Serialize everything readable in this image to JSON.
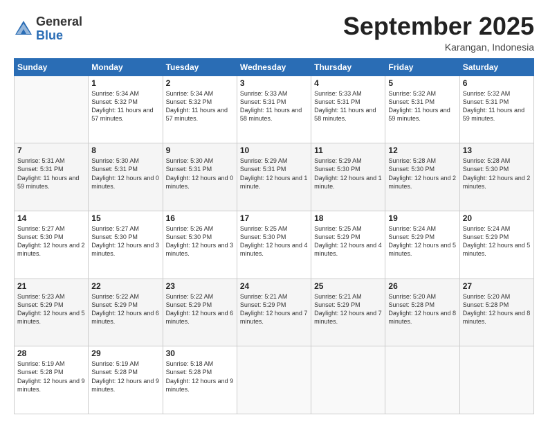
{
  "logo": {
    "general": "General",
    "blue": "Blue"
  },
  "header": {
    "month": "September 2025",
    "location": "Karangan, Indonesia"
  },
  "weekdays": [
    "Sunday",
    "Monday",
    "Tuesday",
    "Wednesday",
    "Thursday",
    "Friday",
    "Saturday"
  ],
  "weeks": [
    [
      {
        "day": "",
        "sunrise": "",
        "sunset": "",
        "daylight": ""
      },
      {
        "day": "1",
        "sunrise": "Sunrise: 5:34 AM",
        "sunset": "Sunset: 5:32 PM",
        "daylight": "Daylight: 11 hours and 57 minutes."
      },
      {
        "day": "2",
        "sunrise": "Sunrise: 5:34 AM",
        "sunset": "Sunset: 5:32 PM",
        "daylight": "Daylight: 11 hours and 57 minutes."
      },
      {
        "day": "3",
        "sunrise": "Sunrise: 5:33 AM",
        "sunset": "Sunset: 5:31 PM",
        "daylight": "Daylight: 11 hours and 58 minutes."
      },
      {
        "day": "4",
        "sunrise": "Sunrise: 5:33 AM",
        "sunset": "Sunset: 5:31 PM",
        "daylight": "Daylight: 11 hours and 58 minutes."
      },
      {
        "day": "5",
        "sunrise": "Sunrise: 5:32 AM",
        "sunset": "Sunset: 5:31 PM",
        "daylight": "Daylight: 11 hours and 59 minutes."
      },
      {
        "day": "6",
        "sunrise": "Sunrise: 5:32 AM",
        "sunset": "Sunset: 5:31 PM",
        "daylight": "Daylight: 11 hours and 59 minutes."
      }
    ],
    [
      {
        "day": "7",
        "sunrise": "Sunrise: 5:31 AM",
        "sunset": "Sunset: 5:31 PM",
        "daylight": "Daylight: 11 hours and 59 minutes."
      },
      {
        "day": "8",
        "sunrise": "Sunrise: 5:30 AM",
        "sunset": "Sunset: 5:31 PM",
        "daylight": "Daylight: 12 hours and 0 minutes."
      },
      {
        "day": "9",
        "sunrise": "Sunrise: 5:30 AM",
        "sunset": "Sunset: 5:31 PM",
        "daylight": "Daylight: 12 hours and 0 minutes."
      },
      {
        "day": "10",
        "sunrise": "Sunrise: 5:29 AM",
        "sunset": "Sunset: 5:31 PM",
        "daylight": "Daylight: 12 hours and 1 minute."
      },
      {
        "day": "11",
        "sunrise": "Sunrise: 5:29 AM",
        "sunset": "Sunset: 5:30 PM",
        "daylight": "Daylight: 12 hours and 1 minute."
      },
      {
        "day": "12",
        "sunrise": "Sunrise: 5:28 AM",
        "sunset": "Sunset: 5:30 PM",
        "daylight": "Daylight: 12 hours and 2 minutes."
      },
      {
        "day": "13",
        "sunrise": "Sunrise: 5:28 AM",
        "sunset": "Sunset: 5:30 PM",
        "daylight": "Daylight: 12 hours and 2 minutes."
      }
    ],
    [
      {
        "day": "14",
        "sunrise": "Sunrise: 5:27 AM",
        "sunset": "Sunset: 5:30 PM",
        "daylight": "Daylight: 12 hours and 2 minutes."
      },
      {
        "day": "15",
        "sunrise": "Sunrise: 5:27 AM",
        "sunset": "Sunset: 5:30 PM",
        "daylight": "Daylight: 12 hours and 3 minutes."
      },
      {
        "day": "16",
        "sunrise": "Sunrise: 5:26 AM",
        "sunset": "Sunset: 5:30 PM",
        "daylight": "Daylight: 12 hours and 3 minutes."
      },
      {
        "day": "17",
        "sunrise": "Sunrise: 5:25 AM",
        "sunset": "Sunset: 5:30 PM",
        "daylight": "Daylight: 12 hours and 4 minutes."
      },
      {
        "day": "18",
        "sunrise": "Sunrise: 5:25 AM",
        "sunset": "Sunset: 5:29 PM",
        "daylight": "Daylight: 12 hours and 4 minutes."
      },
      {
        "day": "19",
        "sunrise": "Sunrise: 5:24 AM",
        "sunset": "Sunset: 5:29 PM",
        "daylight": "Daylight: 12 hours and 5 minutes."
      },
      {
        "day": "20",
        "sunrise": "Sunrise: 5:24 AM",
        "sunset": "Sunset: 5:29 PM",
        "daylight": "Daylight: 12 hours and 5 minutes."
      }
    ],
    [
      {
        "day": "21",
        "sunrise": "Sunrise: 5:23 AM",
        "sunset": "Sunset: 5:29 PM",
        "daylight": "Daylight: 12 hours and 5 minutes."
      },
      {
        "day": "22",
        "sunrise": "Sunrise: 5:22 AM",
        "sunset": "Sunset: 5:29 PM",
        "daylight": "Daylight: 12 hours and 6 minutes."
      },
      {
        "day": "23",
        "sunrise": "Sunrise: 5:22 AM",
        "sunset": "Sunset: 5:29 PM",
        "daylight": "Daylight: 12 hours and 6 minutes."
      },
      {
        "day": "24",
        "sunrise": "Sunrise: 5:21 AM",
        "sunset": "Sunset: 5:29 PM",
        "daylight": "Daylight: 12 hours and 7 minutes."
      },
      {
        "day": "25",
        "sunrise": "Sunrise: 5:21 AM",
        "sunset": "Sunset: 5:29 PM",
        "daylight": "Daylight: 12 hours and 7 minutes."
      },
      {
        "day": "26",
        "sunrise": "Sunrise: 5:20 AM",
        "sunset": "Sunset: 5:28 PM",
        "daylight": "Daylight: 12 hours and 8 minutes."
      },
      {
        "day": "27",
        "sunrise": "Sunrise: 5:20 AM",
        "sunset": "Sunset: 5:28 PM",
        "daylight": "Daylight: 12 hours and 8 minutes."
      }
    ],
    [
      {
        "day": "28",
        "sunrise": "Sunrise: 5:19 AM",
        "sunset": "Sunset: 5:28 PM",
        "daylight": "Daylight: 12 hours and 9 minutes."
      },
      {
        "day": "29",
        "sunrise": "Sunrise: 5:19 AM",
        "sunset": "Sunset: 5:28 PM",
        "daylight": "Daylight: 12 hours and 9 minutes."
      },
      {
        "day": "30",
        "sunrise": "Sunrise: 5:18 AM",
        "sunset": "Sunset: 5:28 PM",
        "daylight": "Daylight: 12 hours and 9 minutes."
      },
      {
        "day": "",
        "sunrise": "",
        "sunset": "",
        "daylight": ""
      },
      {
        "day": "",
        "sunrise": "",
        "sunset": "",
        "daylight": ""
      },
      {
        "day": "",
        "sunrise": "",
        "sunset": "",
        "daylight": ""
      },
      {
        "day": "",
        "sunrise": "",
        "sunset": "",
        "daylight": ""
      }
    ]
  ]
}
